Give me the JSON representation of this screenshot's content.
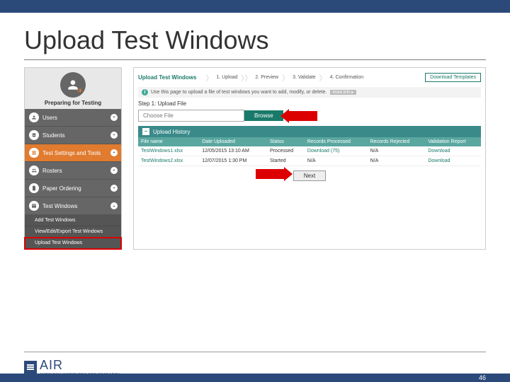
{
  "slide": {
    "title": "Upload Test Windows",
    "page_number": "46"
  },
  "logo": {
    "text": "AIR",
    "subtitle": "AMERICAN INSTITUTES FOR RESEARCH"
  },
  "sidebar": {
    "header": "Preparing for Testing",
    "items": [
      {
        "label": "Users"
      },
      {
        "label": "Students"
      },
      {
        "label": "Test Settings and Tools"
      },
      {
        "label": "Rosters"
      },
      {
        "label": "Paper Ordering"
      },
      {
        "label": "Test Windows"
      }
    ],
    "subitems": [
      {
        "label": "Add Test Windows"
      },
      {
        "label": "View/Edit/Export Test Windows"
      },
      {
        "label": "Upload Test Windows"
      }
    ]
  },
  "main": {
    "panel_title": "Upload Test Windows",
    "steps": [
      "1. Upload",
      "2. Preview",
      "3. Validate",
      "4. Confirmation"
    ],
    "download_templates": "Download Templates",
    "info_text": "Use this page to upload a file of test windows you want to add, modify, or delete.",
    "more_info": "more info ▸",
    "step_label": "Step 1: Upload File",
    "choose_file": "Choose File",
    "browse": "Browse",
    "history_title": "Upload History",
    "columns": [
      "File name",
      "Date Uploaded",
      "Status",
      "Records Processed",
      "Records Rejected",
      "Validation Report"
    ],
    "rows": [
      {
        "file": "TestWindows1.xlsx",
        "date": "12/05/2015 13:10 AM",
        "status": "Processed",
        "processed": "Download (75)",
        "rejected": "N/A",
        "report": "Download"
      },
      {
        "file": "TestWindows2.xlsx",
        "date": "12/07/2015 1:30 PM",
        "status": "Started",
        "processed": "N/A",
        "rejected": "N/A",
        "report": "Download"
      }
    ],
    "next": "Next"
  }
}
